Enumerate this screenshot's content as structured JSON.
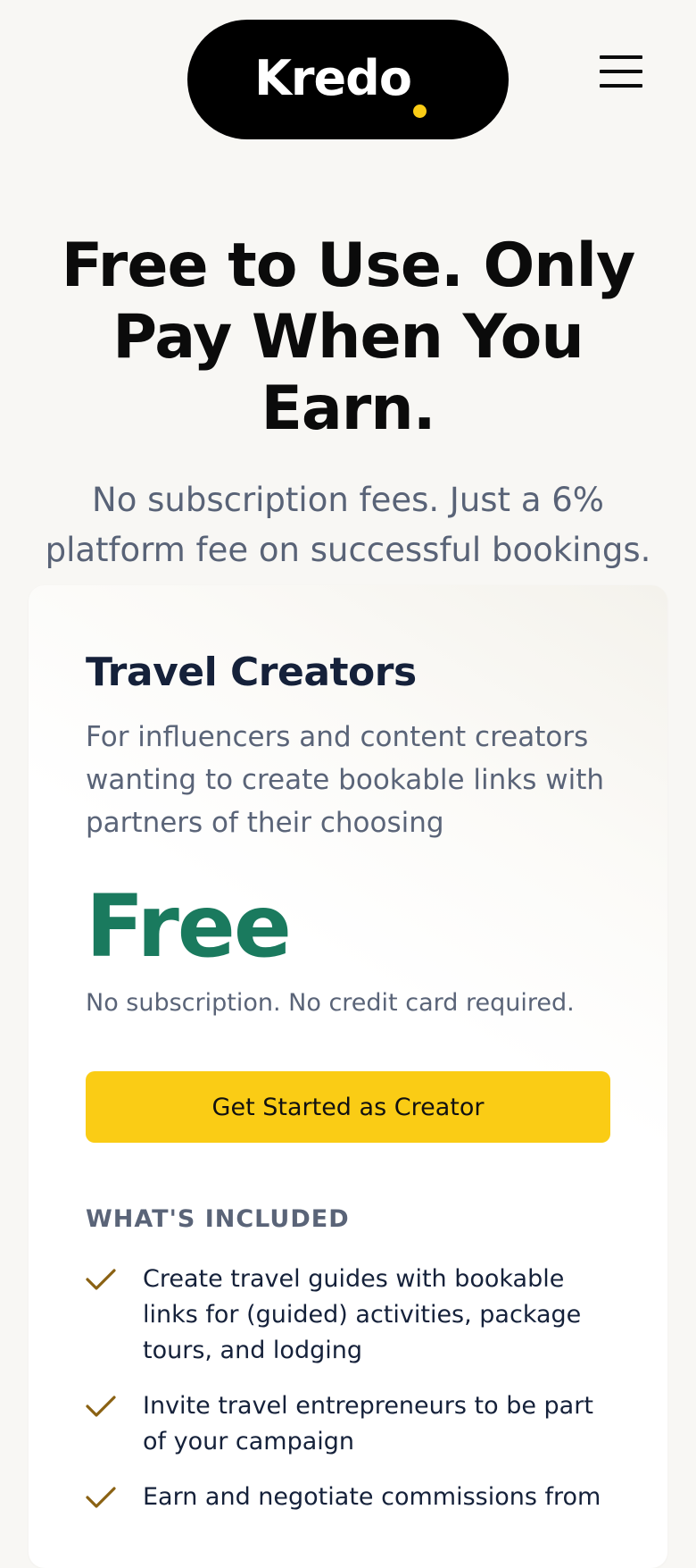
{
  "header": {
    "logo_text": "Kredo",
    "logo_dot_color": "#facc15",
    "menu_icon": "hamburger-menu-icon"
  },
  "hero": {
    "title": "Free to Use. Only Pay When You Earn.",
    "subtitle": "No subscription fees. Just a 6% platform fee on successful bookings."
  },
  "card": {
    "title": "Travel Creators",
    "description": "For influencers and content creators wanting to create bookable links with partners of their choosing",
    "price": "Free",
    "price_note": "No subscription. No credit card required.",
    "cta_label": "Get Started as Creator",
    "cta_color": "#facc15",
    "price_color": "#1a7a5e",
    "included_heading": "WHAT'S INCLUDED",
    "check_color": "#8a6112",
    "features": [
      "Create travel guides with bookable links for (guided) activities, package tours, and lodging",
      "Invite travel entrepreneurs to be part of your campaign",
      "Earn and negotiate commissions from"
    ]
  }
}
